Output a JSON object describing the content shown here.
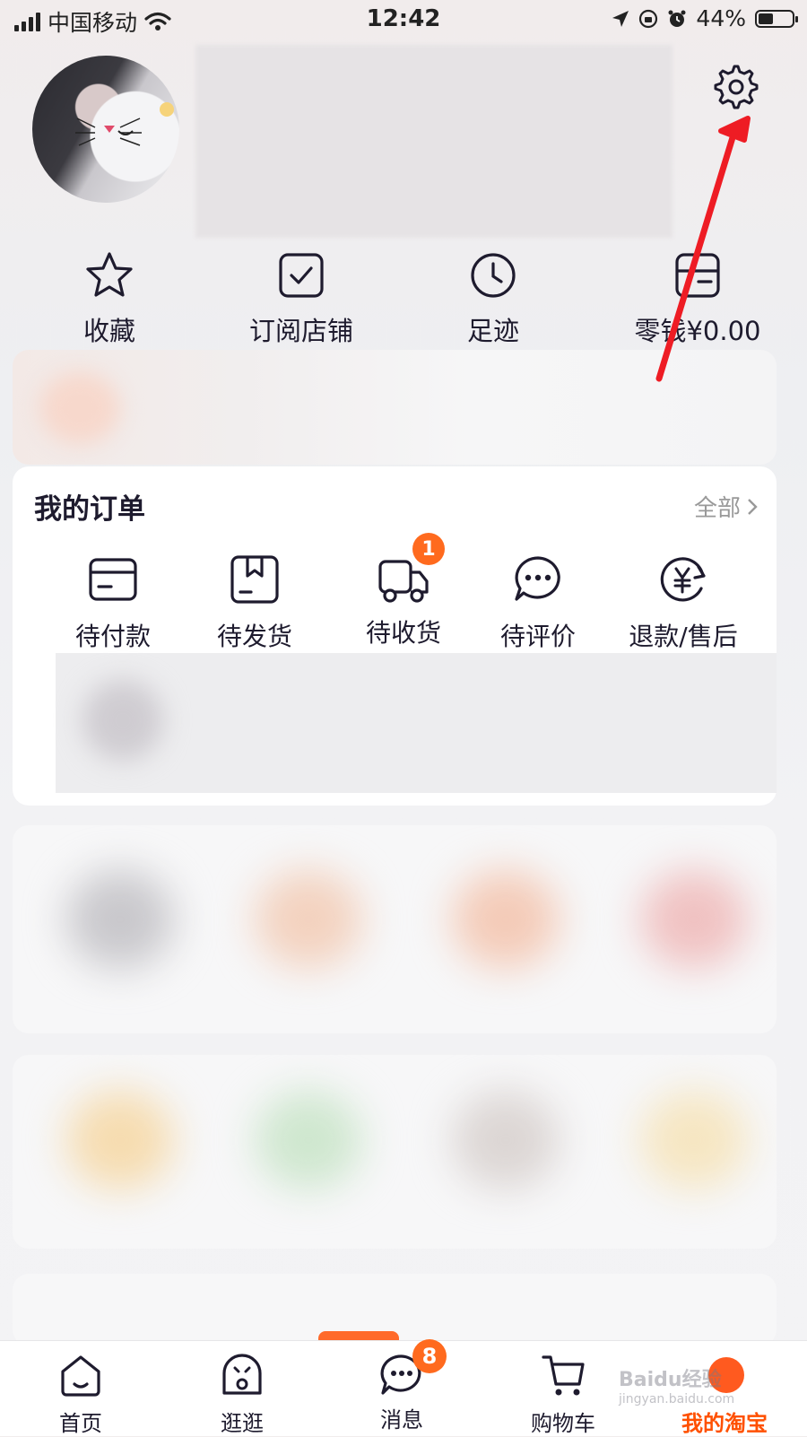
{
  "status_bar": {
    "carrier": "中国移动",
    "time": "12:42",
    "battery": "44%",
    "battery_level": 0.44
  },
  "quick_actions": [
    {
      "label": "收藏",
      "icon": "star-icon"
    },
    {
      "label": "订阅店铺",
      "icon": "store-check-icon"
    },
    {
      "label": "足迹",
      "icon": "clock-icon"
    },
    {
      "label": "零钱¥0.00",
      "icon": "wallet-icon"
    }
  ],
  "orders": {
    "title": "我的订单",
    "all_label": "全部",
    "items": [
      {
        "label": "待付款",
        "icon": "card-icon",
        "badge": ""
      },
      {
        "label": "待发货",
        "icon": "box-icon",
        "badge": ""
      },
      {
        "label": "待收货",
        "icon": "truck-icon",
        "badge": "1"
      },
      {
        "label": "待评价",
        "icon": "chat-dots-icon",
        "badge": ""
      },
      {
        "label": "退款/售后",
        "icon": "refund-icon",
        "badge": ""
      }
    ]
  },
  "tabs": [
    {
      "label": "首页",
      "icon": "home-icon",
      "badge": ""
    },
    {
      "label": "逛逛",
      "icon": "explore-icon",
      "badge": ""
    },
    {
      "label": "消息",
      "icon": "message-icon",
      "badge": "8"
    },
    {
      "label": "购物车",
      "icon": "cart-icon",
      "badge": ""
    },
    {
      "label": "我的淘宝",
      "icon": "profile-icon",
      "badge": ""
    }
  ],
  "watermark": {
    "main": "Baidu经验",
    "sub": "jingyan.baidu.com"
  },
  "colors": {
    "accent": "#ff5000",
    "badge": "#ff6a1e",
    "annotation": "#ee1c24",
    "icon": "#1e1b2e"
  }
}
